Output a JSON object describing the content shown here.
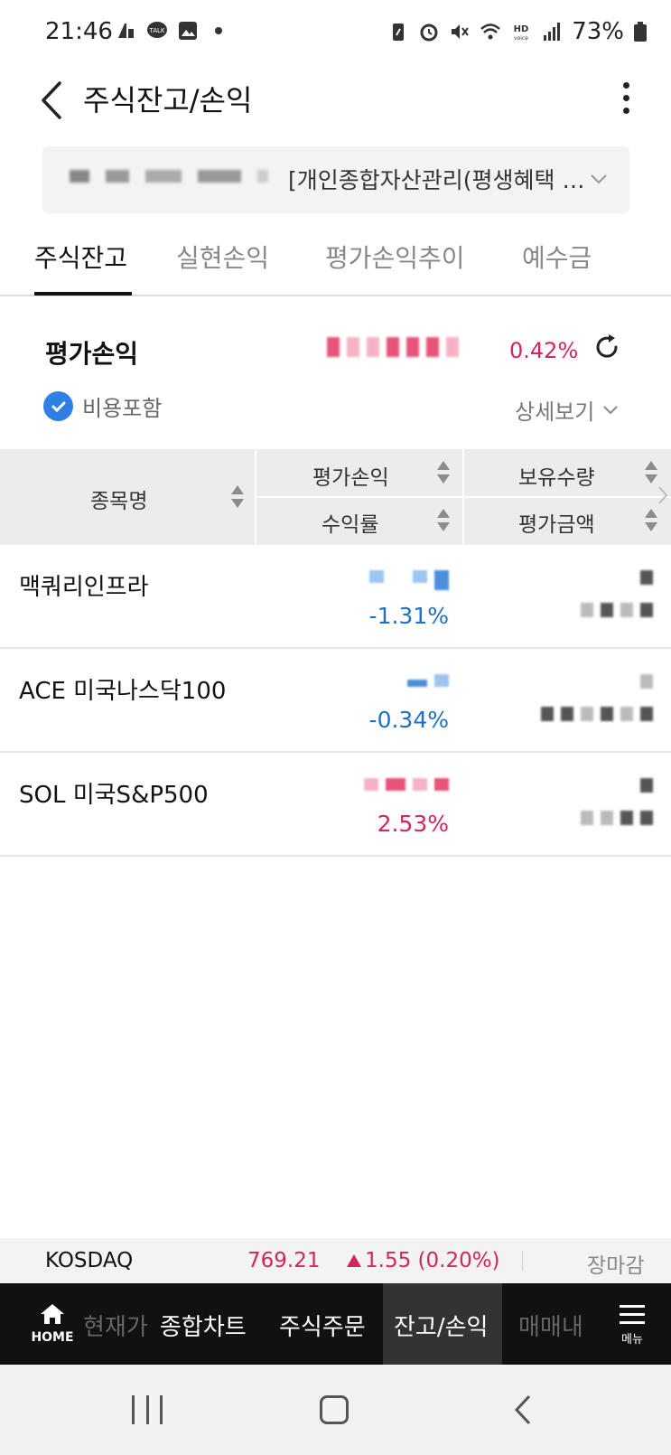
{
  "status_bar": {
    "time": "21:46",
    "battery": "73%",
    "icons": [
      "signal-icon",
      "talk-icon",
      "gallery-icon",
      "dot-icon",
      "battery-saver-icon",
      "alarm-icon",
      "mute-icon",
      "wifi-icon",
      "hd-voice-icon",
      "cell-signal-icon",
      "battery-icon"
    ]
  },
  "header": {
    "title": "주식잔고/손익",
    "back_icon": "chevron-left-icon",
    "more_icon": "more-vertical-icon"
  },
  "account": {
    "name": "[개인종합자산관리(평생혜택 중…"
  },
  "tabs": [
    {
      "label": "주식잔고",
      "active": true
    },
    {
      "label": "실현손익",
      "active": false
    },
    {
      "label": "평가손익추이",
      "active": false
    },
    {
      "label": "예수금",
      "active": false
    }
  ],
  "summary": {
    "label": "평가손익",
    "rate": "0.42%",
    "include_cost_label": "비용포함",
    "include_cost_checked": true,
    "detail_label": "상세보기"
  },
  "table": {
    "headers": {
      "name": "종목명",
      "eval_pl": "평가손익",
      "return_rate": "수익률",
      "quantity": "보유수량",
      "eval_amount": "평가금액"
    },
    "rows": [
      {
        "name": "맥쿼리인프라",
        "rate": "-1.31%",
        "direction": "down"
      },
      {
        "name": "ACE 미국나스닥100",
        "rate": "-0.34%",
        "direction": "down"
      },
      {
        "name": "SOL 미국S&P500",
        "rate": "2.53%",
        "direction": "up"
      }
    ]
  },
  "ticker": {
    "name": "KOSDAQ",
    "value": "769.21",
    "change": "1.55 (0.20%)",
    "status": "장마감"
  },
  "bottom_nav": {
    "home_label": "HOME",
    "items": [
      "현재가",
      "종합차트",
      "주식주문",
      "잔고/손익",
      "매매내"
    ],
    "active": "잔고/손익",
    "menu_label": "메뉴"
  },
  "colors": {
    "up": "#d6245c",
    "down": "#1f6fc6",
    "accent": "#2f7fe5"
  }
}
